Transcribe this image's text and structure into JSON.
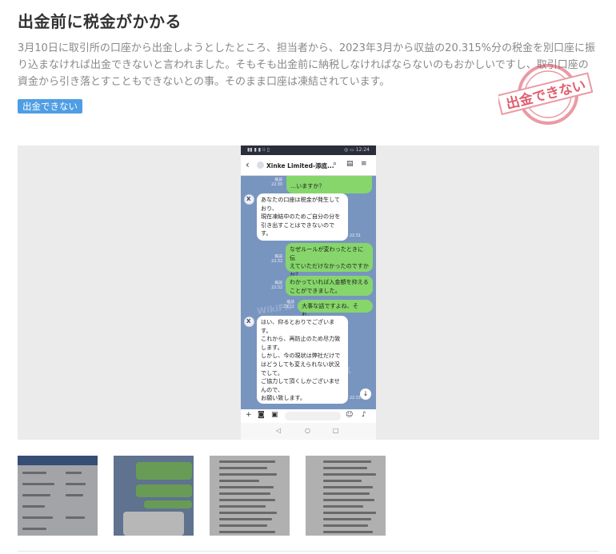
{
  "post": {
    "title": "出金前に税金がかかる",
    "description": "3月10日に取引所の口座から出金しようとしたところ、担当者から、2023年3月から収益の20.315%分の税金を別口座に振り込まなければ出金できないと言われました。そもそも出金前に納税しなければならないのもおかしいですし、取引口座の資金から引き落とすこともできないとの事。そのまま口座は凍結されています。",
    "tag": "出金できない",
    "stamp_text": "出金できない"
  },
  "phone": {
    "status_left": "▮▮ ▮ ▮ ⁞⁞ ▯",
    "status_right": "◎ ▭ 12:24",
    "chat_title": "Xinke Limited-添底...",
    "watermark": "WikiFX",
    "messages": [
      {
        "dir": "out",
        "text": "…いますか？",
        "meta": "既読\n22:30"
      },
      {
        "dir": "in",
        "text": "あなたの口座は税金が発生して\nおり、\n現在凍結中のためご自分の分を\n引き出すことはできないので\nす。",
        "meta": "22:31"
      },
      {
        "dir": "out",
        "text": "なぜルールが変わったときに伝\nえていただけなかったのですか\nか？",
        "meta": "既読\n22:32"
      },
      {
        "dir": "out",
        "text": "わかっていれば入金額を抑える\nことができました。",
        "meta": "既読\n22:32"
      },
      {
        "dir": "out",
        "text": "大事な話ですよね、それ。",
        "meta": "既読\n22:32"
      },
      {
        "dir": "in",
        "text": "はい、仰るとおりでございま\nす。\nこれから、再防止のため尽力致\nします。\nしかし、今の現状は弊社だけで\nはどうしても変えられない状況\nでして。\nご協力して頂くしかございませ\nんので、\nお願い致します。",
        "meta": "22:33"
      }
    ]
  },
  "thumbnails": [
    {
      "label": "thumbnail-1"
    },
    {
      "label": "thumbnail-2"
    },
    {
      "label": "thumbnail-3"
    },
    {
      "label": "thumbnail-4"
    }
  ]
}
